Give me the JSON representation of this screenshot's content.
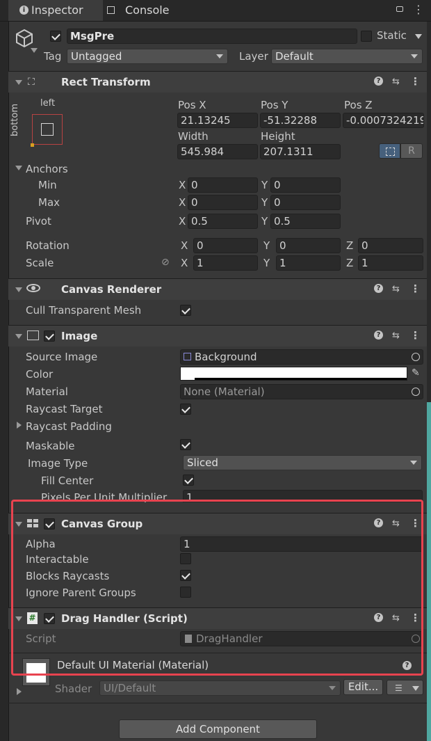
{
  "tabs": {
    "inspector": "Inspector",
    "console": "Console"
  },
  "object": {
    "name": "MsgPre",
    "static_label": "Static",
    "tag_label": "Tag",
    "tag_value": "Untagged",
    "layer_label": "Layer",
    "layer_value": "Default"
  },
  "rect_transform": {
    "title": "Rect Transform",
    "anchor_h": "left",
    "anchor_v": "bottom",
    "posx_label": "Pos X",
    "posy_label": "Pos Y",
    "posz_label": "Pos Z",
    "posx": "21.13245",
    "posy": "-51.32288",
    "posz": "-0.0007324219",
    "width_label": "Width",
    "height_label": "Height",
    "width": "545.984",
    "height": "207.1311",
    "r_btn": "R",
    "anchors_label": "Anchors",
    "min_label": "Min",
    "max_label": "Max",
    "pivot_label": "Pivot",
    "x": "X",
    "y": "Y",
    "z": "Z",
    "min_x": "0",
    "min_y": "0",
    "max_x": "0",
    "max_y": "0",
    "pivot_x": "0.5",
    "pivot_y": "0.5",
    "rotation_label": "Rotation",
    "scale_label": "Scale",
    "rot_x": "0",
    "rot_y": "0",
    "rot_z": "0",
    "scale_x": "1",
    "scale_y": "1",
    "scale_z": "1"
  },
  "canvas_renderer": {
    "title": "Canvas Renderer",
    "cull_label": "Cull Transparent Mesh"
  },
  "image": {
    "title": "Image",
    "source_label": "Source Image",
    "source_value": "Background",
    "color_label": "Color",
    "material_label": "Material",
    "material_value": "None (Material)",
    "raycast_target_label": "Raycast Target",
    "raycast_padding_label": "Raycast Padding",
    "maskable_label": "Maskable",
    "image_type_label": "Image Type",
    "image_type_value": "Sliced",
    "fill_center_label": "Fill Center",
    "ppu_label": "Pixels Per Unit Multiplier",
    "ppu_value": "1"
  },
  "canvas_group": {
    "title": "Canvas Group",
    "alpha_label": "Alpha",
    "alpha_value": "1",
    "interactable_label": "Interactable",
    "blocks_label": "Blocks Raycasts",
    "ignore_label": "Ignore Parent Groups"
  },
  "drag_handler": {
    "title": "Drag Handler (Script)",
    "script_label": "Script",
    "script_value": "DragHandler"
  },
  "material": {
    "title": "Default UI Material (Material)",
    "shader_label": "Shader",
    "shader_value": "UI/Default",
    "edit_label": "Edit..."
  },
  "add_component": "Add Component",
  "colors": {
    "highlight": "#e8434f",
    "accent_teal": "#4fa7a0",
    "selected_blue": "#46607c"
  }
}
